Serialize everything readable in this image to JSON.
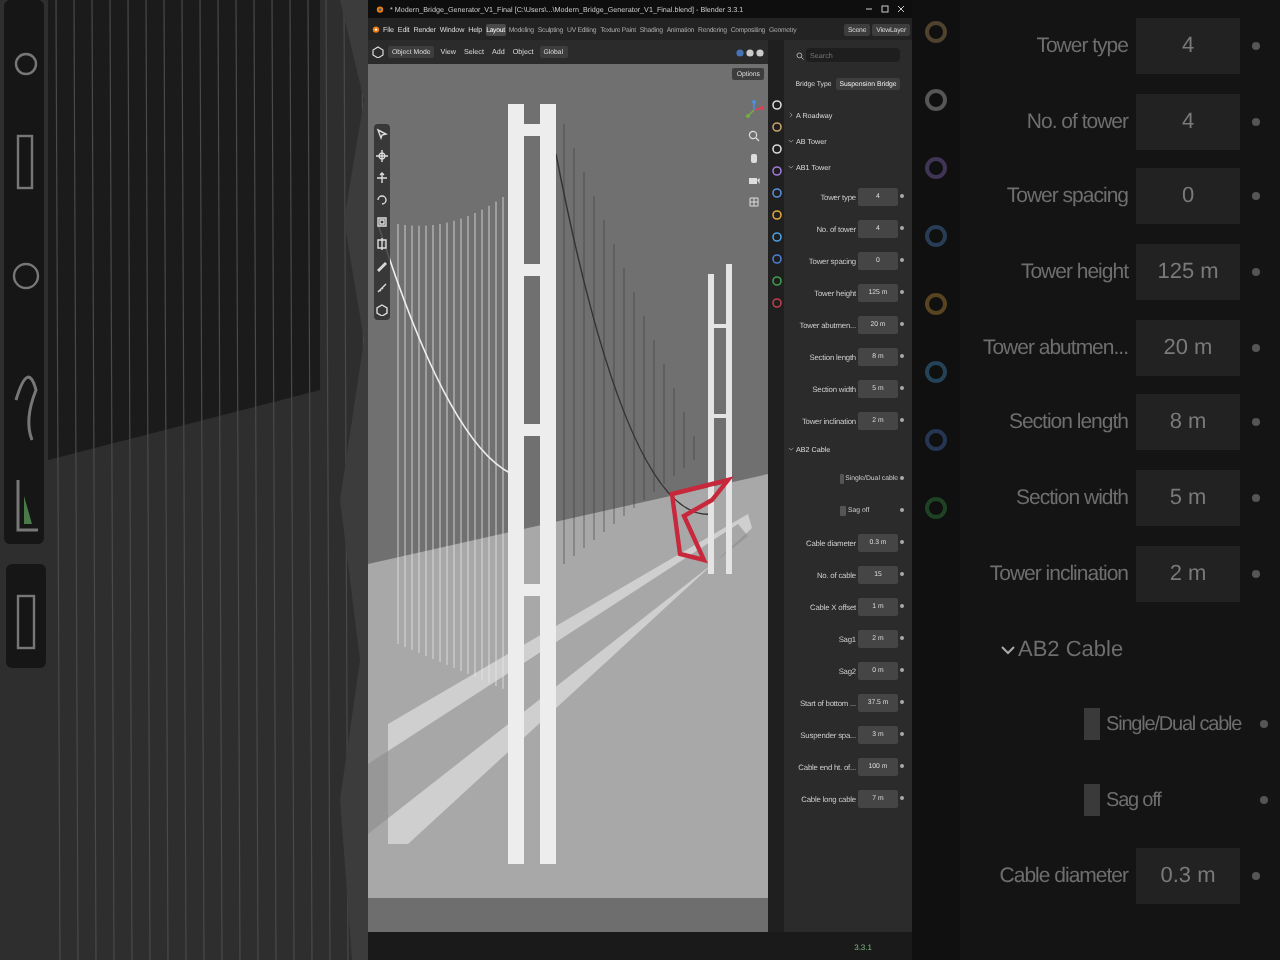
{
  "window": {
    "title": "* Modern_Bridge_Generator_V1_Final [C:\\Users\\...\\Modern_Bridge_Generator_V1_Final.blend] - Blender 3.3.1"
  },
  "menus": [
    "File",
    "Edit",
    "Render",
    "Window",
    "Help"
  ],
  "workspace_tabs": [
    {
      "label": "Layout",
      "selected": true
    },
    {
      "label": "Modeling",
      "selected": false
    },
    {
      "label": "Sculpting",
      "selected": false
    },
    {
      "label": "UV Editing",
      "selected": false
    },
    {
      "label": "Texture Paint",
      "selected": false
    },
    {
      "label": "Shading",
      "selected": false
    },
    {
      "label": "Animation",
      "selected": false
    },
    {
      "label": "Rendering",
      "selected": false
    },
    {
      "label": "Compositing",
      "selected": false
    },
    {
      "label": "Geometry",
      "selected": false
    }
  ],
  "scene": "Scene",
  "view_layer": "ViewLayer",
  "viewport": {
    "mode": "Object Mode",
    "menus": [
      "View",
      "Select",
      "Add",
      "Object"
    ],
    "orientation": "Global",
    "options": "Options"
  },
  "properties": {
    "search_placeholder": "Search",
    "bridge_type": {
      "label": "Bridge Type",
      "value": "Suspension Bridge"
    },
    "rows": [
      {
        "kind": "section",
        "label": "A Roadway",
        "expanded": false
      },
      {
        "kind": "section",
        "label": "AB Tower",
        "expanded": true
      },
      {
        "kind": "section",
        "label": "AB1 Tower",
        "expanded": true
      },
      {
        "kind": "number",
        "label": "Tower type",
        "value": "4"
      },
      {
        "kind": "number",
        "label": "No. of tower",
        "value": "4"
      },
      {
        "kind": "number",
        "label": "Tower spacing",
        "value": "0"
      },
      {
        "kind": "number",
        "label": "Tower height",
        "value": "125 m"
      },
      {
        "kind": "number",
        "label": "Tower abutmen...",
        "value": "20 m"
      },
      {
        "kind": "number",
        "label": "Section length",
        "value": "8 m"
      },
      {
        "kind": "number",
        "label": "Section width",
        "value": "5 m"
      },
      {
        "kind": "number",
        "label": "Tower inclination",
        "value": "2 m"
      },
      {
        "kind": "section",
        "label": "AB2 Cable",
        "expanded": true
      },
      {
        "kind": "checkbox",
        "label": "Single/Dual cable",
        "checked": false
      },
      {
        "kind": "checkbox",
        "label": "Sag off",
        "checked": false
      },
      {
        "kind": "number",
        "label": "Cable diameter",
        "value": "0.3 m"
      },
      {
        "kind": "number",
        "label": "No. of cable",
        "value": "15"
      },
      {
        "kind": "number",
        "label": "Cable X offset",
        "value": "1 m"
      },
      {
        "kind": "number",
        "label": "Sag1",
        "value": "2 m"
      },
      {
        "kind": "number",
        "label": "Sag2",
        "value": "0 m"
      },
      {
        "kind": "number",
        "label": "Start of bottom ...",
        "value": "37.5 m"
      },
      {
        "kind": "number",
        "label": "Suspender spa...",
        "value": "3 m"
      },
      {
        "kind": "number",
        "label": "Cable end ht. of...",
        "value": "100 m"
      },
      {
        "kind": "number",
        "label": "Cable long cable",
        "value": "7 m"
      }
    ]
  },
  "status_bar": {
    "version": "3.3.1"
  },
  "background_panel": {
    "rows": [
      {
        "kind": "number",
        "label": "Tower type",
        "value": "4"
      },
      {
        "kind": "number",
        "label": "No. of tower",
        "value": "4"
      },
      {
        "kind": "number",
        "label": "Tower spacing",
        "value": "0"
      },
      {
        "kind": "number",
        "label": "Tower height",
        "value": "125 m"
      },
      {
        "kind": "number",
        "label": "Tower abutmen...",
        "value": "20 m"
      },
      {
        "kind": "number",
        "label": "Section length",
        "value": "8 m"
      },
      {
        "kind": "number",
        "label": "Section width",
        "value": "5 m"
      },
      {
        "kind": "number",
        "label": "Tower inclination",
        "value": "2 m"
      },
      {
        "kind": "section",
        "label": "AB2 Cable",
        "expanded": true
      },
      {
        "kind": "checkbox",
        "label": "Single/Dual cable",
        "checked": false
      },
      {
        "kind": "checkbox",
        "label": "Sag off",
        "checked": false
      },
      {
        "kind": "number",
        "label": "Cable diameter",
        "value": "0.3 m"
      }
    ]
  }
}
